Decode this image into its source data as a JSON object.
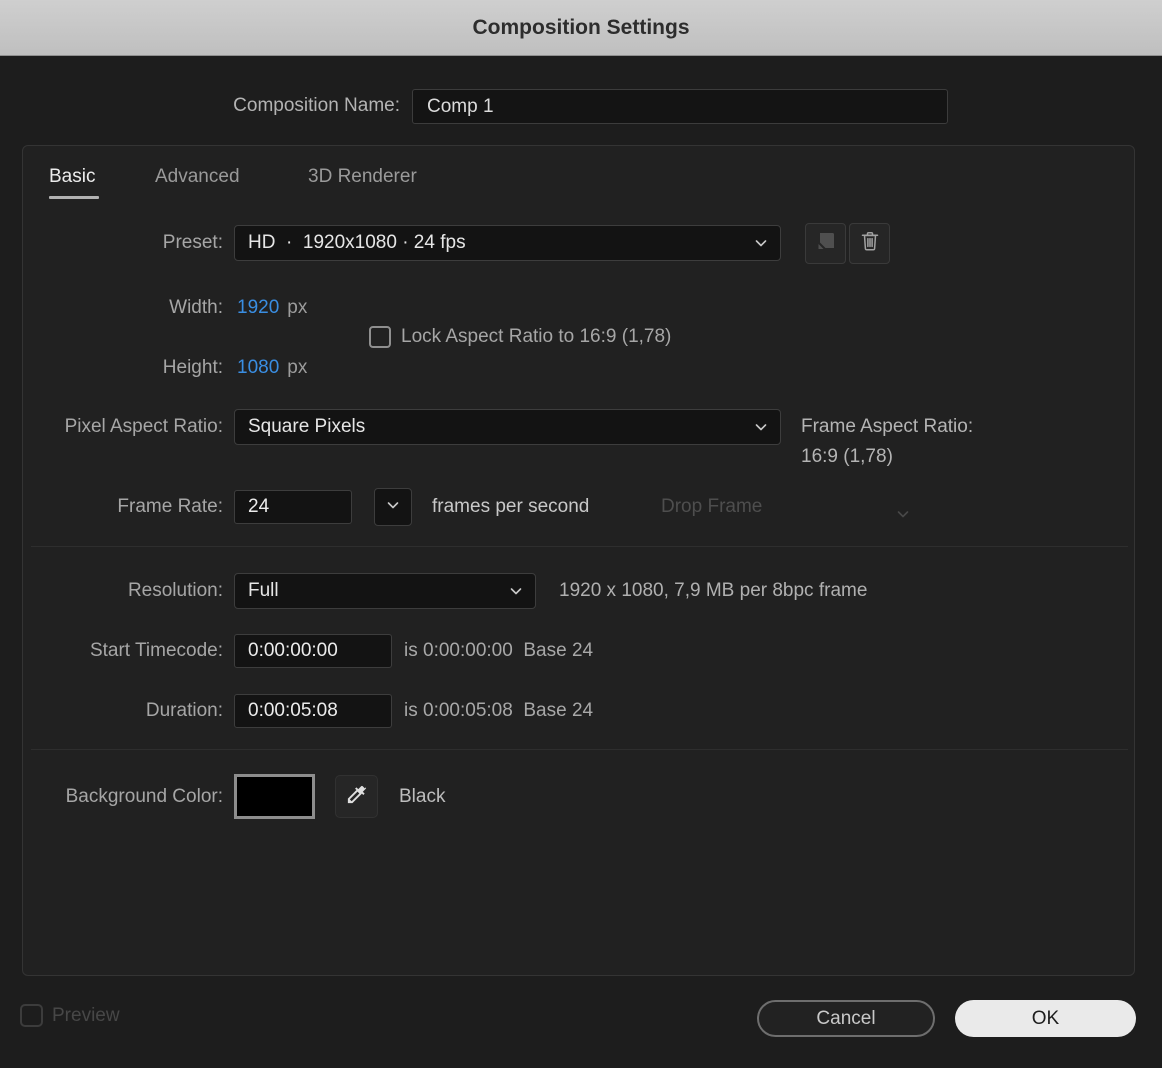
{
  "title_bar": {
    "title": "Composition Settings"
  },
  "name_row": {
    "label": "Composition Name:",
    "value": "Comp 1"
  },
  "tabs": {
    "basic": "Basic",
    "advanced": "Advanced",
    "renderer": "3D Renderer",
    "active": "Basic"
  },
  "preset_row": {
    "label": "Preset:",
    "value": "HD  ·  1920x1080 · 24 fps"
  },
  "size": {
    "width_label": "Width:",
    "width_value": "1920",
    "width_unit": "px",
    "height_label": "Height:",
    "height_value": "1080",
    "height_unit": "px",
    "lock_aspect_label": "Lock Aspect Ratio to 16:9 (1,78)",
    "lock_aspect_checked": false
  },
  "pixel_aspect_row": {
    "label": "Pixel Aspect Ratio:",
    "value": "Square Pixels",
    "frame_aspect_label": "Frame Aspect Ratio:",
    "frame_aspect_value": "16:9 (1,78)"
  },
  "frame_rate_row": {
    "label": "Frame Rate:",
    "value": "24",
    "units_label": "frames per second",
    "drop_frame_label": "Drop Frame",
    "drop_frame_enabled": false
  },
  "resolution_row": {
    "label": "Resolution:",
    "value": "Full",
    "info": "1920 x 1080, 7,9 MB per 8bpc frame"
  },
  "start_timecode_row": {
    "label": "Start Timecode:",
    "value": "0:00:00:00",
    "info": "is 0:00:00:00  Base 24"
  },
  "duration_row": {
    "label": "Duration:",
    "value": "0:00:05:08",
    "info": "is 0:00:05:08  Base 24"
  },
  "background_row": {
    "label": "Background Color:",
    "swatch_color": "#000000",
    "color_name": "Black"
  },
  "footer": {
    "preview_label": "Preview",
    "preview_checked": false,
    "cancel_label": "Cancel",
    "ok_label": "OK"
  },
  "icons": {
    "preset_dropdown": "chevron-down",
    "pixel_aspect_dropdown": "chevron-down",
    "frame_rate_dropdown": "chevron-down",
    "drop_frame_dropdown": "chevron-down",
    "resolution_dropdown": "chevron-down",
    "save_preset": "save-preset",
    "delete_preset": "trash",
    "color_picker": "eyedropper"
  },
  "colors": {
    "accent_value_blue": "#3a8ee2",
    "title_bar_bg": "#c7c7c7",
    "dialog_bg": "#1d1d1d",
    "ok_button_bg": "#eaeaea",
    "background_swatch": "#000000"
  }
}
